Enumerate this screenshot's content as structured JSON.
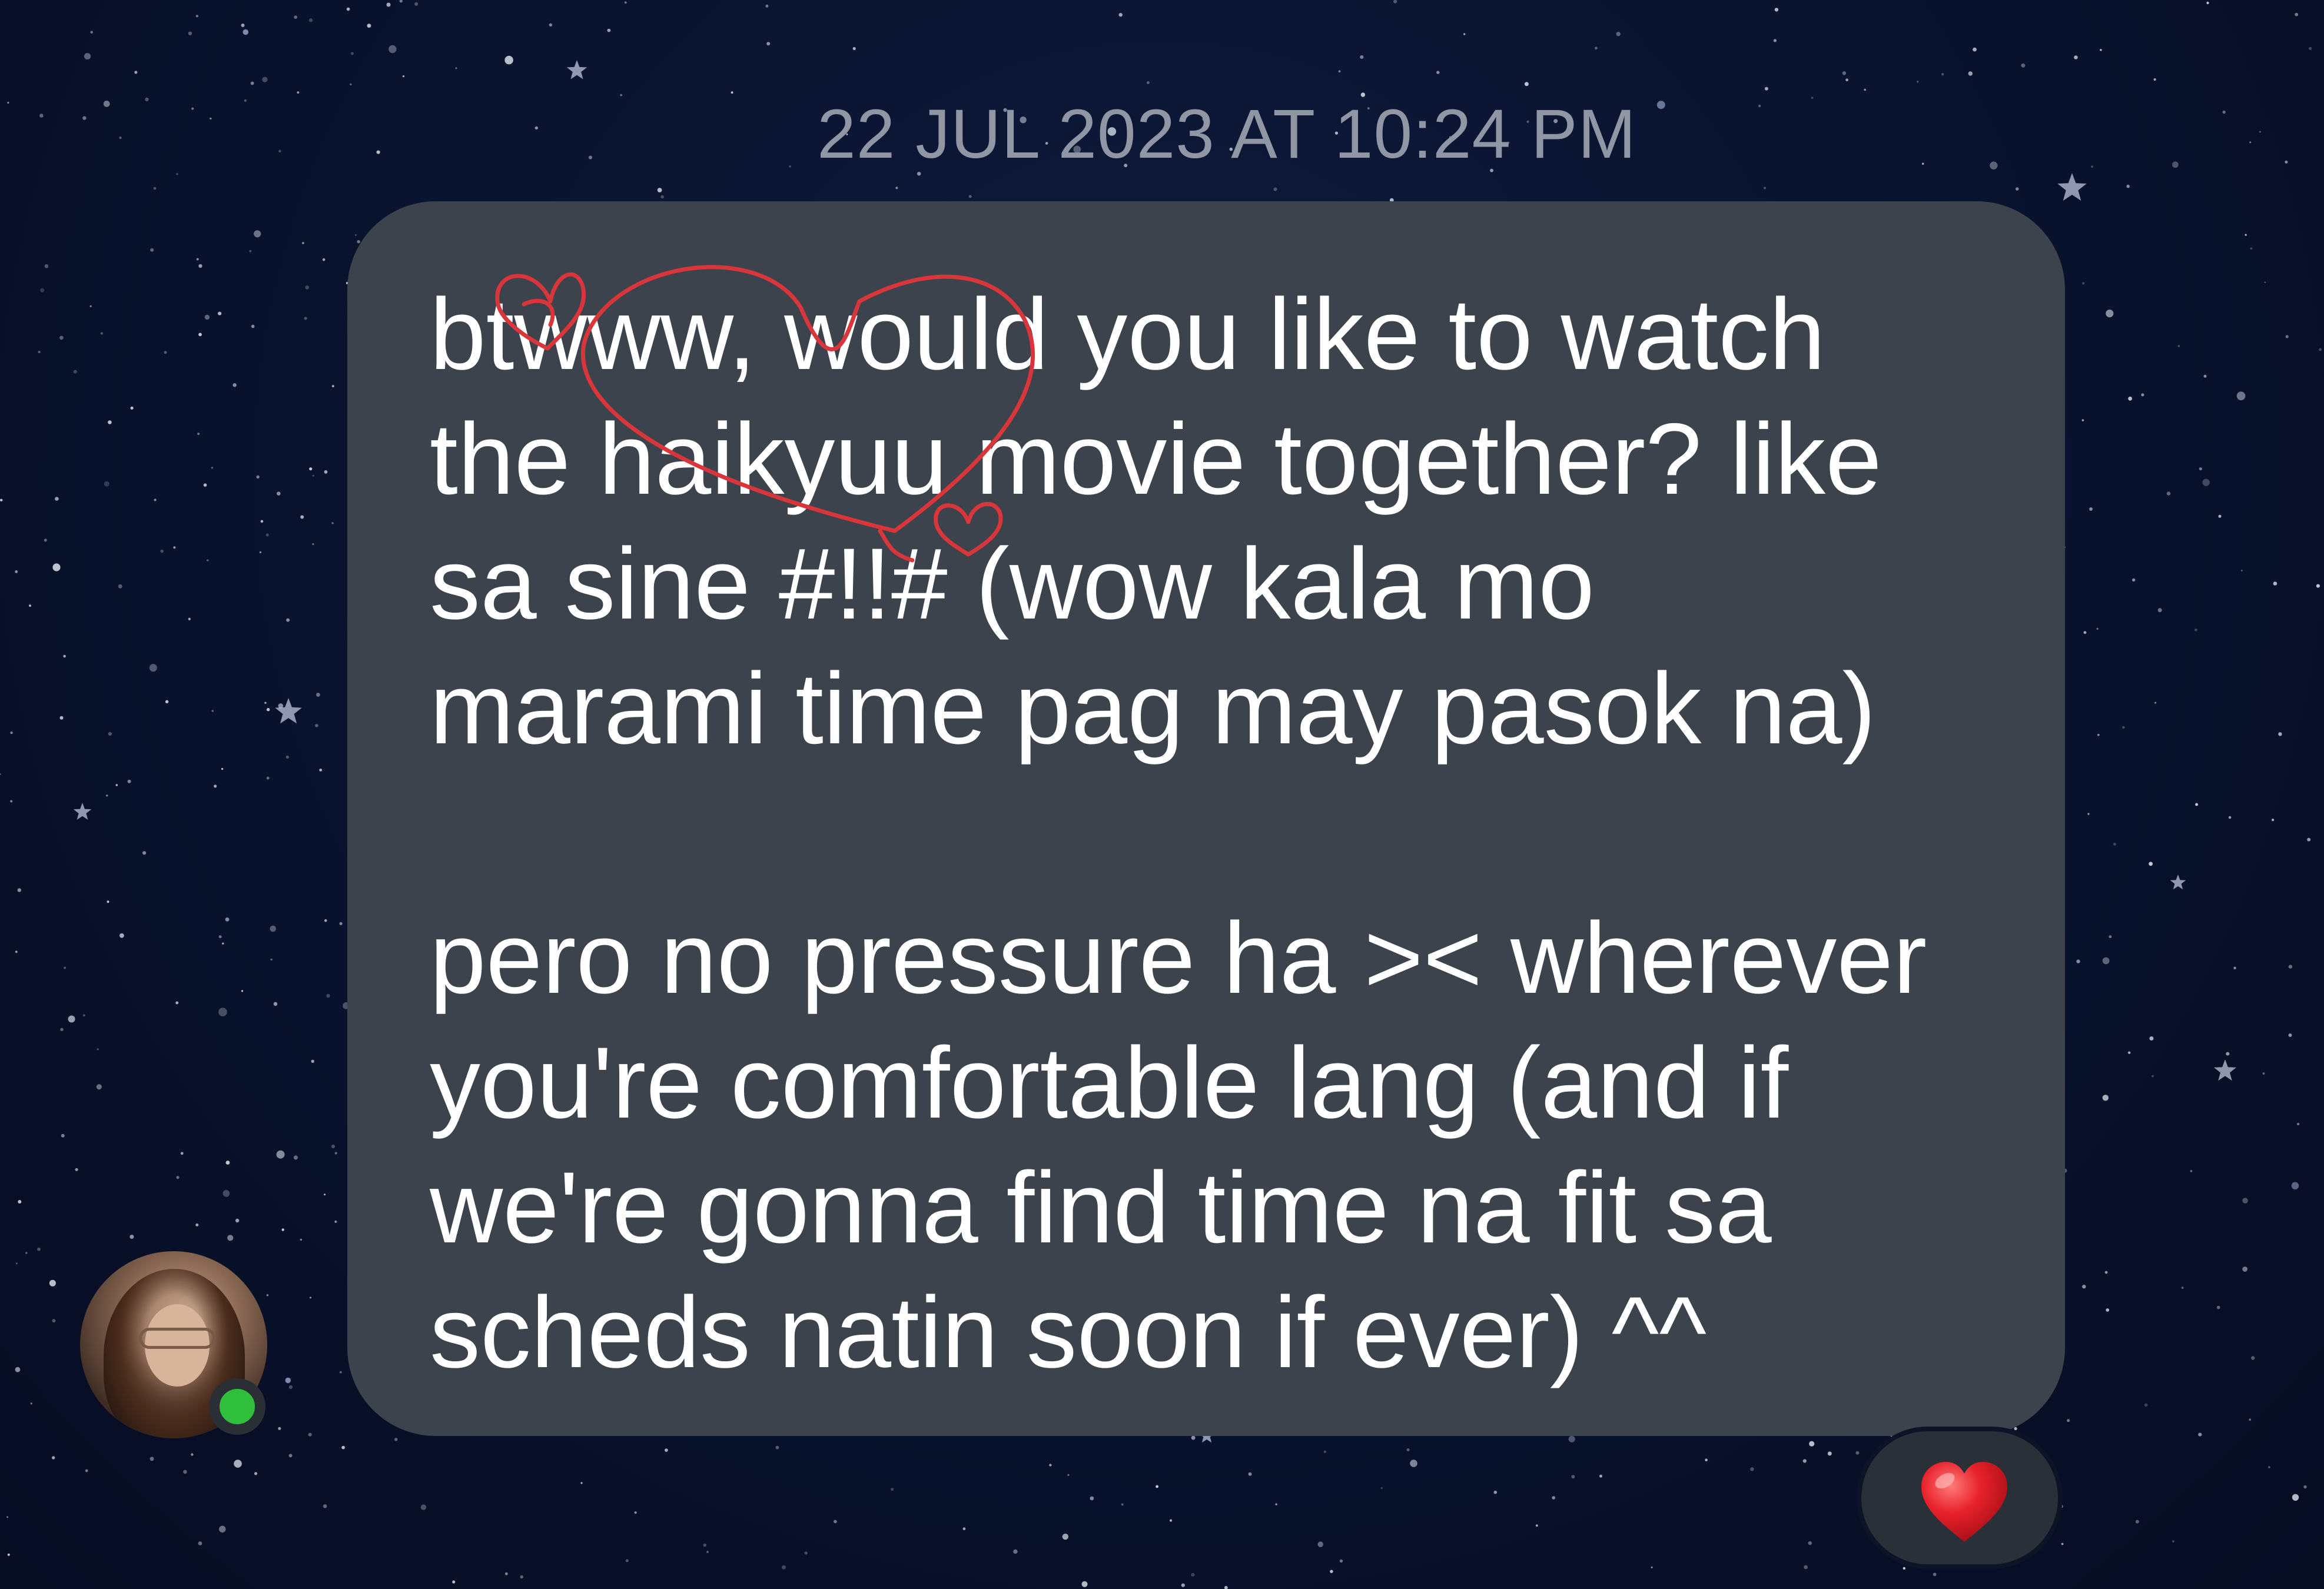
{
  "chat": {
    "timestamp": "22 JUL 2023 AT 10:24 PM",
    "message": {
      "paragraph1": "btwww, would you like to watch\nthe haikyuu movie together? like\nsa sine #!!#  (wow kala mo\nmarami time pag may pasok na)",
      "paragraph2": "pero no pressure ha >< wherever\nyou're comfortable lang (and if\nwe're gonna find time na fit sa\nscheds natin soon if ever) ^^"
    },
    "sender": {
      "online_status_color": "#2fbf3c"
    },
    "reaction": {
      "emoji_icon": "red-heart-icon"
    },
    "colors": {
      "bubble": "#3c434c",
      "doodle": "#d8363a",
      "background": "#0a1430"
    }
  }
}
